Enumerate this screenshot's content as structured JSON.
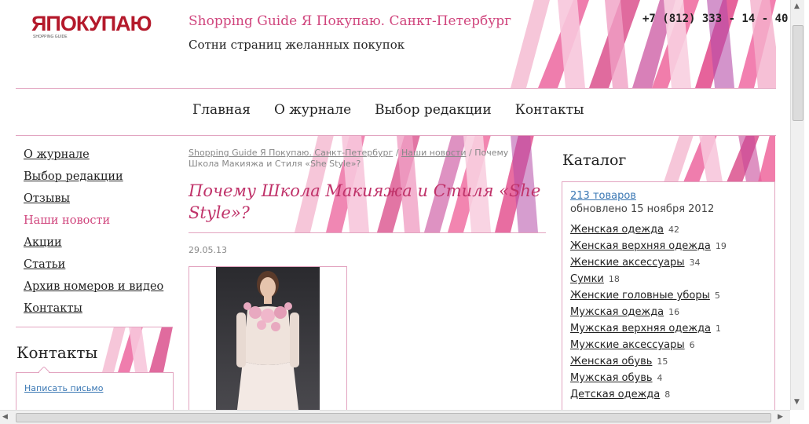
{
  "header": {
    "logo_text": "ЯПОКУПАЮ",
    "logo_sub": "SHOPPING GUIDE",
    "title": "Shopping Guide Я Покупаю. Санкт-Петербург",
    "subtitle": "Сотни страниц желанных покупок",
    "phone": "+7 (812) 333 - 14 - 40"
  },
  "topnav": {
    "items": [
      {
        "label": "Главная"
      },
      {
        "label": "О журнале"
      },
      {
        "label": "Выбор редакции"
      },
      {
        "label": "Контакты"
      }
    ]
  },
  "leftnav": {
    "items": [
      {
        "label": "О журнале",
        "active": false
      },
      {
        "label": "Выбор редакции",
        "active": false
      },
      {
        "label": "Отзывы",
        "active": false
      },
      {
        "label": "Наши новости",
        "active": true
      },
      {
        "label": "Акции",
        "active": false
      },
      {
        "label": "Статьи",
        "active": false
      },
      {
        "label": "Архив номеров и видео",
        "active": false
      },
      {
        "label": "Контакты",
        "active": false
      }
    ]
  },
  "contacts": {
    "title": "Контакты",
    "write_link": "Написать письмо"
  },
  "article": {
    "breadcrumb_home": "Shopping Guide Я Покупаю. Санкт-Петербург",
    "breadcrumb_sep": " / ",
    "breadcrumb_section": "Наши новости",
    "breadcrumb_current": "Почему Школа Макияжа и Стиля «She Style»?",
    "title": "Почему Школа Макияжа и Стиля «She Style»?",
    "date": "29.05.13"
  },
  "catalog": {
    "title": "Каталог",
    "count_link": "213 товаров",
    "updated": "обновлено 15 ноября 2012",
    "items": [
      {
        "label": "Женская одежда",
        "count": "42"
      },
      {
        "label": "Женская верхняя одежда",
        "count": "19"
      },
      {
        "label": "Женские аксессуары",
        "count": "34"
      },
      {
        "label": "Сумки",
        "count": "18"
      },
      {
        "label": "Женские головные уборы",
        "count": "5"
      },
      {
        "label": "Мужская одежда",
        "count": "16"
      },
      {
        "label": "Мужская верхняя одежда",
        "count": "1"
      },
      {
        "label": "Мужские аксессуары",
        "count": "6"
      },
      {
        "label": "Женская обувь",
        "count": "15"
      },
      {
        "label": "Мужская обувь",
        "count": "4"
      },
      {
        "label": "Детская одежда",
        "count": "8"
      }
    ]
  },
  "colors": {
    "accent": "#d0457d",
    "link": "#3b78b4",
    "border": "#e2a4c0"
  }
}
